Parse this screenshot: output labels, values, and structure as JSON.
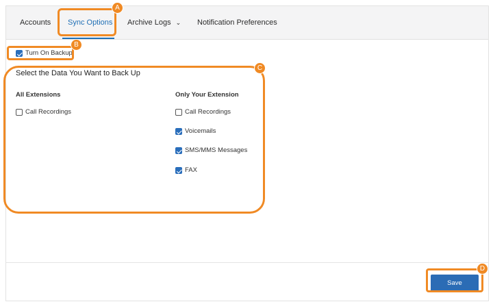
{
  "tabs": [
    {
      "label": "Accounts"
    },
    {
      "label": "Sync Options"
    },
    {
      "label": "Archive Logs"
    },
    {
      "label": "Notification Preferences"
    }
  ],
  "backup": {
    "label": "Turn On Backup",
    "checked": true
  },
  "section_title": "Select the Data You Want to Back Up",
  "all_extensions": {
    "heading": "All Extensions",
    "items": [
      {
        "label": "Call Recordings",
        "checked": false
      }
    ]
  },
  "your_extension": {
    "heading": "Only Your Extension",
    "items": [
      {
        "label": "Call Recordings",
        "checked": false
      },
      {
        "label": "Voicemails",
        "checked": true
      },
      {
        "label": "SMS/MMS Messages",
        "checked": true
      },
      {
        "label": "FAX",
        "checked": true
      }
    ]
  },
  "save_label": "Save",
  "annotations": {
    "a": "A",
    "b": "B",
    "c": "C",
    "d": "D"
  },
  "colors": {
    "accent": "#1f6fb5",
    "highlight": "#f08a24",
    "button": "#2b6cb5"
  }
}
